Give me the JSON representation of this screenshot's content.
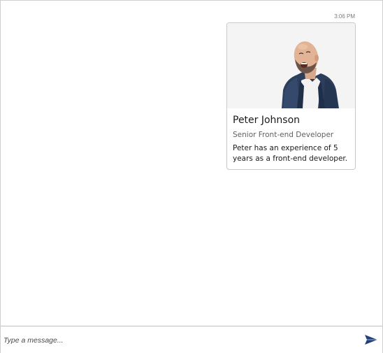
{
  "message": {
    "timestamp": "3:06 PM",
    "card": {
      "title": "Peter Johnson",
      "subtitle": "Senior Front-end Developer",
      "text": "Peter has an experience of 5 years as a front-end developer."
    }
  },
  "composer": {
    "placeholder": "Type a message...",
    "send_icon": "send-icon"
  },
  "colors": {
    "send_icon": "#1f3f7a",
    "card_border": "#c9c9c9"
  }
}
